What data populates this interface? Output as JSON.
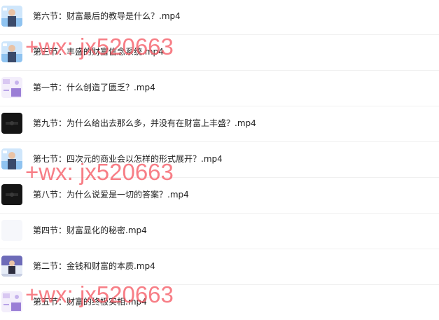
{
  "files": [
    {
      "name": "第六节：财富最后的教导是什么？.mp4",
      "thumb": "person-bright-icon"
    },
    {
      "name": "第三节：丰盛的财富信念系统.mp4",
      "thumb": "person-bright-icon"
    },
    {
      "name": "第一节：什么创造了匮乏？.mp4",
      "thumb": "slide-purple-icon"
    },
    {
      "name": "第九节：为什么给出去那么多，并没有在财富上丰盛？.mp4",
      "thumb": "dark-frame-icon"
    },
    {
      "name": "第七节：四次元的商业会以怎样的形式展开？.mp4",
      "thumb": "person-bright-icon"
    },
    {
      "name": "第八节：为什么说爱是一切的答案？.mp4",
      "thumb": "dark-frame-icon"
    },
    {
      "name": "第四节：财富显化的秘密.mp4",
      "thumb": "blank-frame-icon"
    },
    {
      "name": "第二节：金钱和财富的本质.mp4",
      "thumb": "person-stage-icon"
    },
    {
      "name": "第五节：财富的终极实相.mp4",
      "thumb": "slide-purple-icon"
    }
  ],
  "watermark": {
    "text": "+wx: jx520663",
    "color": "#f55a64"
  }
}
